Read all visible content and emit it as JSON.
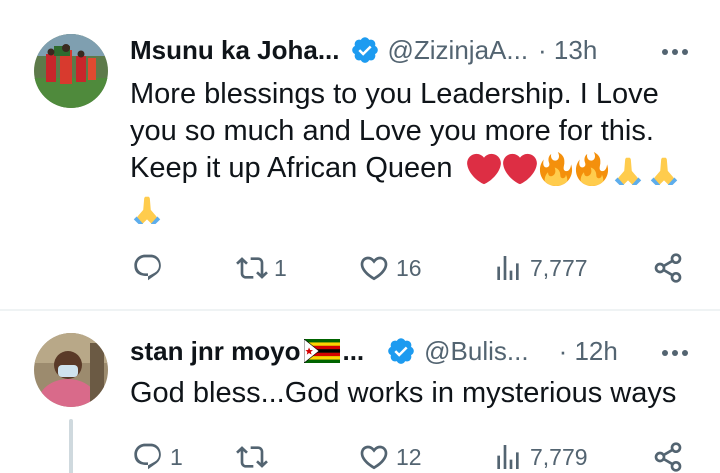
{
  "colors": {
    "text": "#0f1419",
    "muted": "#536471",
    "verified": "#1d9bf0",
    "divider": "#eff3f4"
  },
  "tweets": [
    {
      "display_name": "Msunu ka Joha...",
      "handle": "@ZizinjaA...",
      "time": "· 13h",
      "lines": [
        "More blessings to you Leadership. I Love",
        "you so much and Love you more for this.",
        "Keep it up African Queen"
      ],
      "emojis": [
        "red-heart",
        "red-heart",
        "fire",
        "fire",
        "folded-hands",
        "folded-hands",
        "folded-hands"
      ],
      "reply_count": "",
      "retweet_count": "1",
      "like_count": "16",
      "view_count": "7,777"
    },
    {
      "display_name": "stan jnr moyo",
      "name_suffix": "...",
      "handle": "@Bulis...",
      "time": "· 12h",
      "lines": [
        "God bless...God works in mysterious ways"
      ],
      "emojis": [
        "zimbabwe-flag"
      ],
      "reply_count": "1",
      "retweet_count": "",
      "like_count": "12",
      "view_count": "7,779"
    }
  ]
}
